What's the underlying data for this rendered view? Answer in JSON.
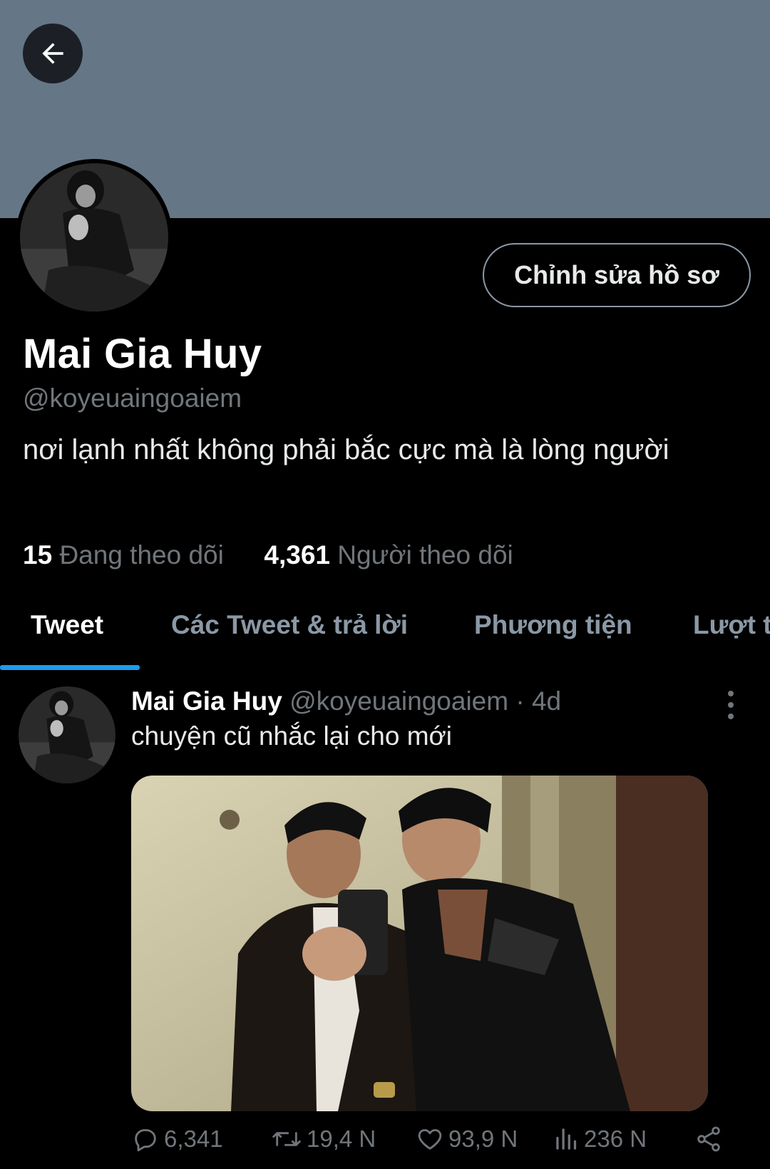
{
  "profile": {
    "name": "Mai Gia Huy",
    "handle": "@koyeuaingoaiem",
    "bio": "nơi lạnh nhất không phải bắc cực mà là lòng người",
    "edit_label": "Chỉnh sửa hồ sơ",
    "following_count": "15",
    "following_label": "Đang theo dõi",
    "followers_count": "4,361",
    "followers_label": "Người theo dõi"
  },
  "tabs": [
    {
      "label": "Tweet",
      "active": true
    },
    {
      "label": "Các Tweet & trả lời",
      "active": false
    },
    {
      "label": "Phương tiện",
      "active": false
    },
    {
      "label": "Lượt thích",
      "active": false
    }
  ],
  "tweet": {
    "name": "Mai Gia Huy",
    "handle": "@koyeuaingoaiem",
    "time": "· 4d",
    "text": "chuyện cũ nhắc lại cho mới",
    "replies": "6,341",
    "retweets": "19,4 N",
    "likes": "93,9 N",
    "views": "236 N"
  },
  "icons": [
    "back-arrow-icon",
    "more-vertical-icon",
    "reply-icon",
    "retweet-icon",
    "like-icon",
    "views-icon",
    "share-icon"
  ],
  "colors": {
    "banner": "#657786",
    "accent": "#1d9bf0",
    "muted": "#71767b"
  }
}
